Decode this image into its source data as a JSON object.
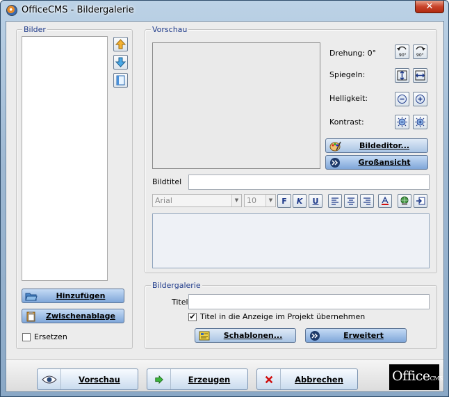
{
  "window": {
    "title": "OfficeCMS - Bildergalerie",
    "close_symbol": "✕"
  },
  "bilder": {
    "legend": "Bilder",
    "add_label": "Hinzufügen",
    "clipboard_label": "Zwischenablage",
    "replace_label": "Ersetzen"
  },
  "vorschau": {
    "legend": "Vorschau",
    "rotation_label": "Drehung: 0°",
    "mirror_label": "Spiegeln:",
    "brightness_label": "Helligkeit:",
    "contrast_label": "Kontrast:",
    "image_editor_label": "Bildeditor...",
    "large_view_label": "Großansicht",
    "rotate_left_text": "90°",
    "rotate_right_text": "90°"
  },
  "bildtitel": {
    "label": "Bildtitel",
    "value": "",
    "font": "Arial",
    "size": "10",
    "bold": "F",
    "italic": "K",
    "underline": "U"
  },
  "galerie": {
    "legend": "Bildergalerie",
    "title_label": "Titel",
    "title_value": "",
    "checkbox_label": "Titel in die Anzeige im Projekt übernehmen",
    "checked": true,
    "check_mark": "✔",
    "templates_label": "Schablonen...",
    "advanced_label": "Erweitert"
  },
  "footer": {
    "preview_label": "Vorschau",
    "create_label": "Erzeugen",
    "cancel_label": "Abbrechen",
    "logo_text": "Office",
    "logo_sub": "CMS"
  }
}
